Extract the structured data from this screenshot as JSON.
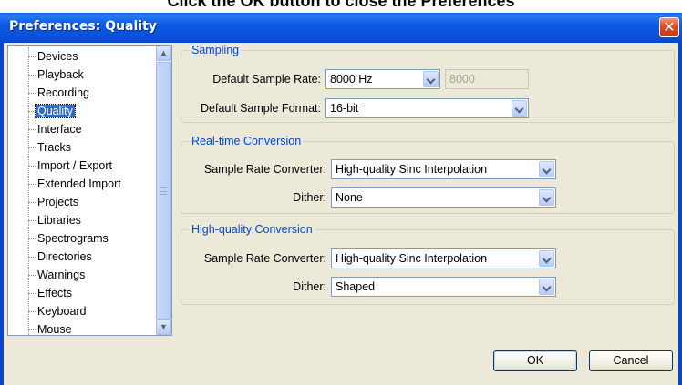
{
  "instruction": {
    "text": "Click the OK button to close the Preferences"
  },
  "window": {
    "title": "Preferences: Quality"
  },
  "tree": {
    "items": [
      {
        "label": "Devices"
      },
      {
        "label": "Playback"
      },
      {
        "label": "Recording"
      },
      {
        "label": "Quality",
        "selected": true
      },
      {
        "label": "Interface"
      },
      {
        "label": "Tracks"
      },
      {
        "label": "Import / Export"
      },
      {
        "label": "Extended Import"
      },
      {
        "label": "Projects"
      },
      {
        "label": "Libraries"
      },
      {
        "label": "Spectrograms"
      },
      {
        "label": "Directories"
      },
      {
        "label": "Warnings"
      },
      {
        "label": "Effects"
      },
      {
        "label": "Keyboard"
      },
      {
        "label": "Mouse"
      }
    ]
  },
  "sampling": {
    "title": "Sampling",
    "rate_label": "Default Sample Rate:",
    "rate_value": "8000 Hz",
    "rate_custom": "8000",
    "format_label": "Default Sample Format:",
    "format_value": "16-bit"
  },
  "realtime": {
    "title": "Real-time Conversion",
    "converter_label": "Sample Rate Converter:",
    "converter_value": "High-quality Sinc Interpolation",
    "dither_label": "Dither:",
    "dither_value": "None"
  },
  "highquality": {
    "title": "High-quality Conversion",
    "converter_label": "Sample Rate Converter:",
    "converter_value": "High-quality Sinc Interpolation",
    "dither_label": "Dither:",
    "dither_value": "Shaped"
  },
  "buttons": {
    "ok": "OK",
    "cancel": "Cancel"
  },
  "colors": {
    "titlebar": "#0a5de0",
    "group_title": "#0046d5",
    "selection": "#316ac5"
  }
}
